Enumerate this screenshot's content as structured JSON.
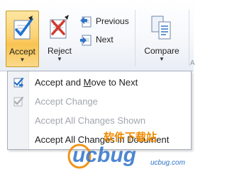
{
  "ribbon": {
    "accept": {
      "label": "Accept",
      "icon": "accept-change-icon"
    },
    "reject": {
      "label": "Reject",
      "icon": "reject-change-icon"
    },
    "previous": {
      "label": "Previous",
      "icon": "previous-change-icon"
    },
    "next": {
      "label": "Next",
      "icon": "next-change-icon"
    },
    "compare": {
      "label": "Compare",
      "icon": "compare-documents-icon"
    },
    "group_fragment": "A"
  },
  "menu": {
    "items": [
      {
        "pre": "Accept and ",
        "mnemonic": "M",
        "post": "ove to Next",
        "enabled": true,
        "icon": "accept-move-next-icon"
      },
      {
        "label": "Accept Change",
        "enabled": false,
        "icon": "accept-change-icon"
      },
      {
        "label": "Accept All Changes Shown",
        "enabled": false
      },
      {
        "label": "Accept All Changes in Document",
        "enabled": true
      }
    ]
  },
  "watermark": {
    "text_cn": "软件下载站",
    "logo": "ucbug",
    "domain": "ucbug.com"
  },
  "colors": {
    "accent_orange": "#f08a00",
    "watermark_blue": "#2f73c9",
    "selected_button": "#fcd276"
  }
}
